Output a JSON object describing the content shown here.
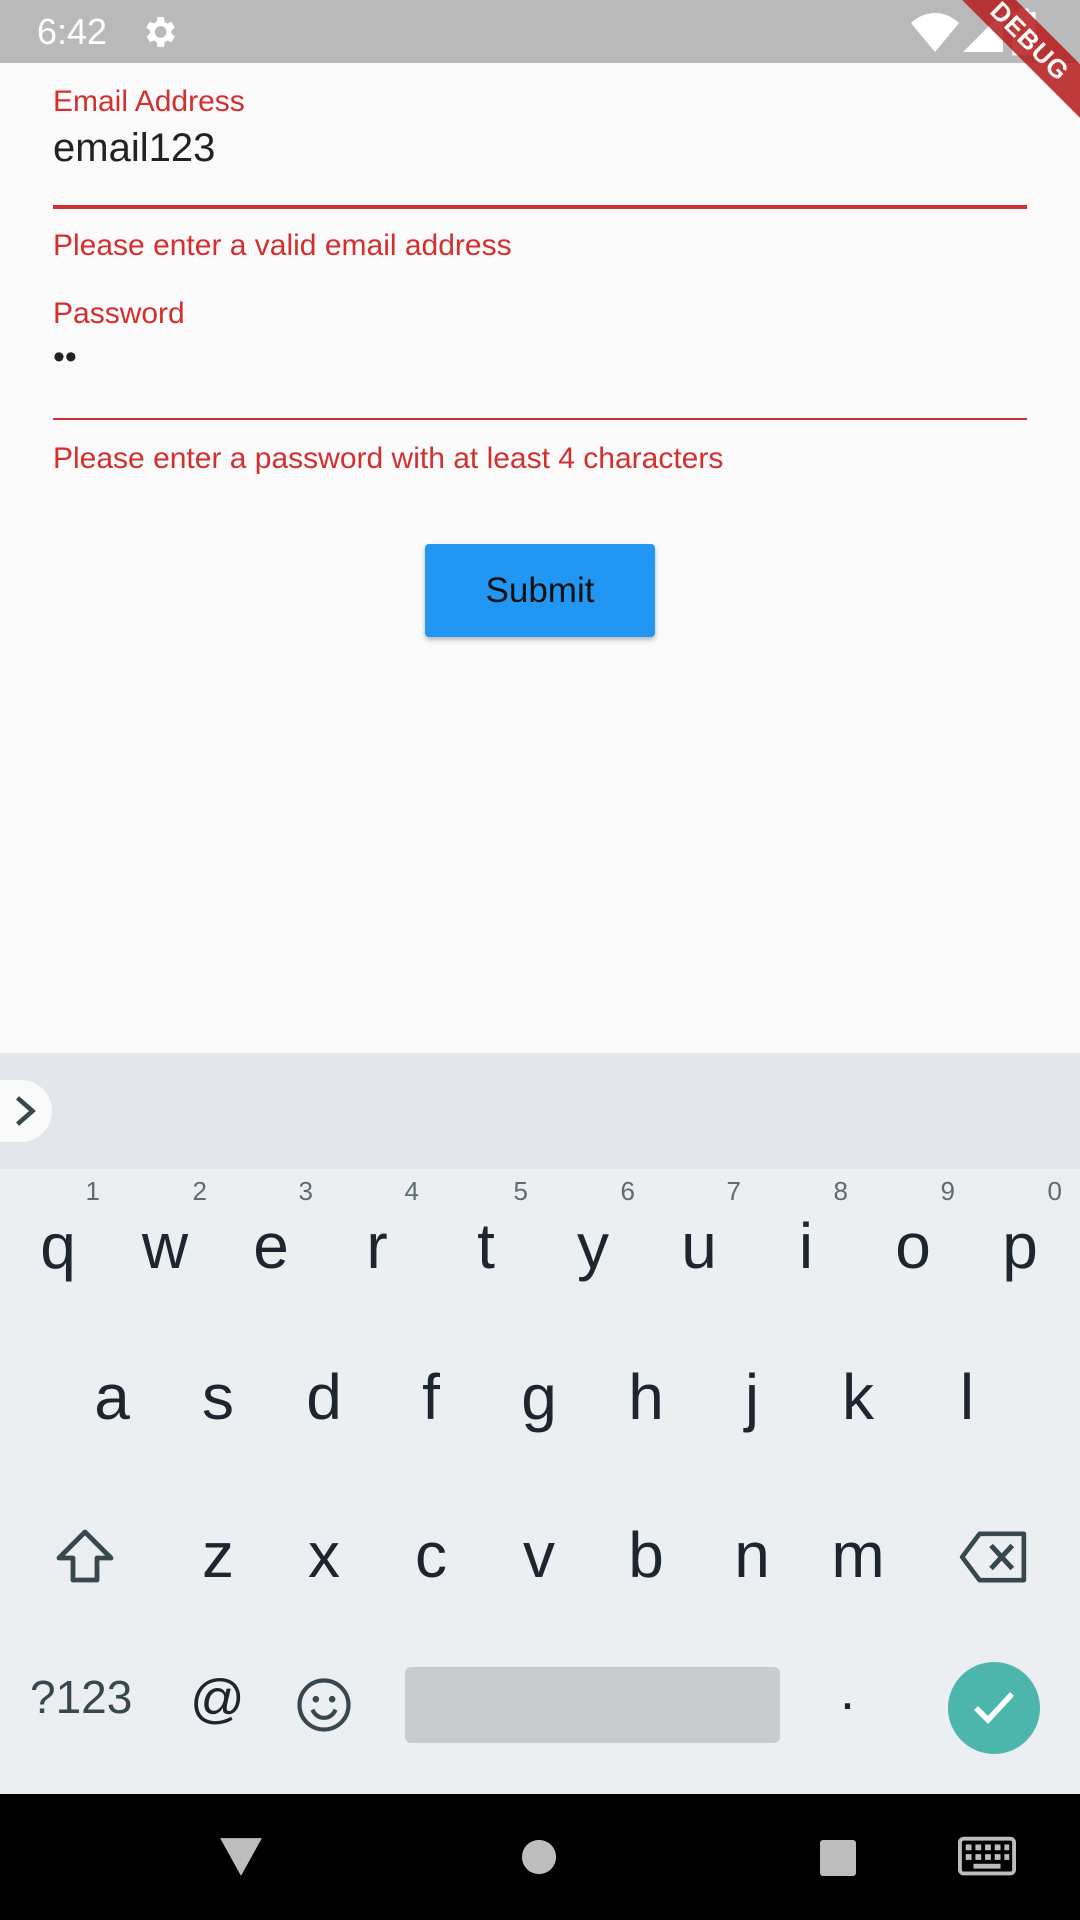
{
  "status_bar": {
    "time": "6:42"
  },
  "debug_banner": "DEBUG",
  "form": {
    "email": {
      "label": "Email Address",
      "value": "email123",
      "error": "Please enter a valid email address"
    },
    "password": {
      "label": "Password",
      "value": "••",
      "error": "Please enter a password with at least 4 characters"
    },
    "submit_label": "Submit"
  },
  "keyboard": {
    "row1": [
      "q",
      "w",
      "e",
      "r",
      "t",
      "y",
      "u",
      "i",
      "o",
      "p"
    ],
    "row1_hints": [
      "1",
      "2",
      "3",
      "4",
      "5",
      "6",
      "7",
      "8",
      "9",
      "0"
    ],
    "row2": [
      "a",
      "s",
      "d",
      "f",
      "g",
      "h",
      "j",
      "k",
      "l"
    ],
    "row3": [
      "z",
      "x",
      "c",
      "v",
      "b",
      "n",
      "m"
    ],
    "symbols_label": "?123",
    "at_label": "@",
    "period_label": "."
  },
  "colors": {
    "error": "#d32f2f",
    "primary": "#2196f3",
    "enter": "#4db6ac"
  }
}
